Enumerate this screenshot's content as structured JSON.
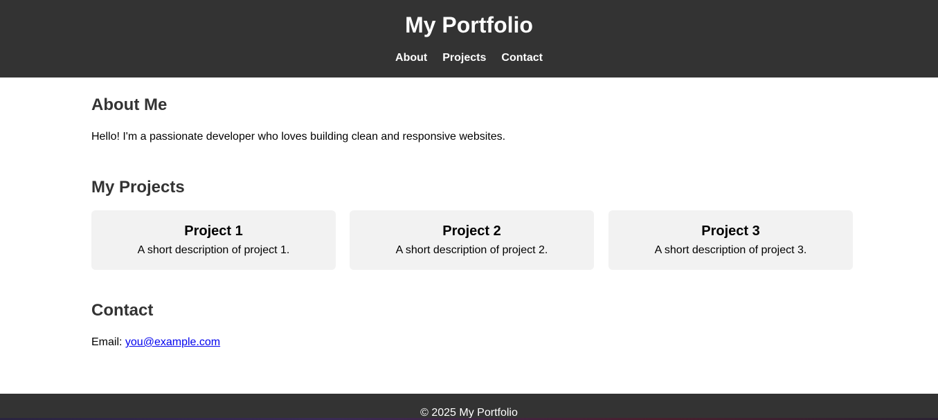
{
  "header": {
    "title": "My Portfolio",
    "nav": [
      {
        "label": "About"
      },
      {
        "label": "Projects"
      },
      {
        "label": "Contact"
      }
    ]
  },
  "about": {
    "heading": "About Me",
    "text": "Hello! I'm a passionate developer who loves building clean and responsive websites."
  },
  "projects": {
    "heading": "My Projects",
    "items": [
      {
        "title": "Project 1",
        "description": "A short description of project 1."
      },
      {
        "title": "Project 2",
        "description": "A short description of project 2."
      },
      {
        "title": "Project 3",
        "description": "A short description of project 3."
      }
    ]
  },
  "contact": {
    "heading": "Contact",
    "email_label": "Email:",
    "email": "you@example.com"
  },
  "footer": {
    "text": "© 2025 My Portfolio"
  },
  "colors": {
    "header_bg": "#333333",
    "card_bg": "#f2f2f2",
    "link": "#0000ee"
  }
}
